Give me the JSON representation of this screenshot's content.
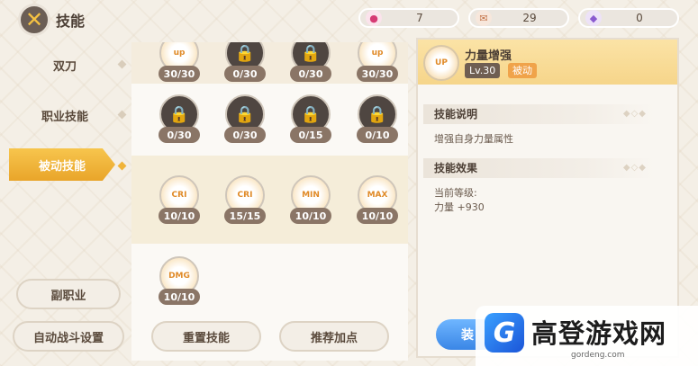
{
  "header": {
    "title": "技能",
    "resources": [
      {
        "icon": "pink-gem-icon",
        "value": "7"
      },
      {
        "icon": "scroll-icon",
        "value": "29"
      },
      {
        "icon": "purple-crystal-icon",
        "value": "0"
      }
    ]
  },
  "nav": {
    "items": [
      {
        "label": "双刀",
        "active": false
      },
      {
        "label": "职业技能",
        "active": false
      },
      {
        "label": "被动技能",
        "active": true
      }
    ],
    "sub_class_label": "副职业",
    "auto_battle_label": "自动战斗设置"
  },
  "grid": {
    "rows": [
      [
        {
          "level": "30/30",
          "locked": false,
          "icon": "up"
        },
        {
          "level": "0/30",
          "locked": true
        },
        {
          "level": "0/30",
          "locked": true
        },
        {
          "level": "30/30",
          "locked": false,
          "icon": "up"
        }
      ],
      [
        {
          "level": "0/30",
          "locked": true
        },
        {
          "level": "0/30",
          "locked": true
        },
        {
          "level": "0/15",
          "locked": true
        },
        {
          "level": "0/10",
          "locked": true
        }
      ],
      [
        {
          "level": "10/10",
          "locked": false,
          "icon": "CRI"
        },
        {
          "level": "15/15",
          "locked": false,
          "icon": "CRI"
        },
        {
          "level": "10/10",
          "locked": false,
          "icon": "MIN"
        },
        {
          "level": "10/10",
          "locked": false,
          "icon": "MAX"
        }
      ],
      [
        {
          "level": "10/10",
          "locked": false,
          "icon": "DMG"
        }
      ]
    ],
    "reset_label": "重置技能",
    "recommend_label": "推荐加点"
  },
  "detail": {
    "name": "力量增强",
    "level": "Lv.30",
    "type": "被动",
    "icon_text": "UP",
    "desc_title": "技能说明",
    "desc_text": "增强自身力量属性",
    "effect_title": "技能效果",
    "current_level_label": "当前等级:",
    "effect_value": "力量  +930",
    "equip_label": "装"
  },
  "watermark": {
    "name": "高登游戏网",
    "url": "gordeng.com"
  },
  "colors": {
    "accent": "#f0b43a",
    "locked_icon": "#4f4641",
    "level_badge": "#8a7566",
    "equip_blue": "#3a86e6"
  }
}
